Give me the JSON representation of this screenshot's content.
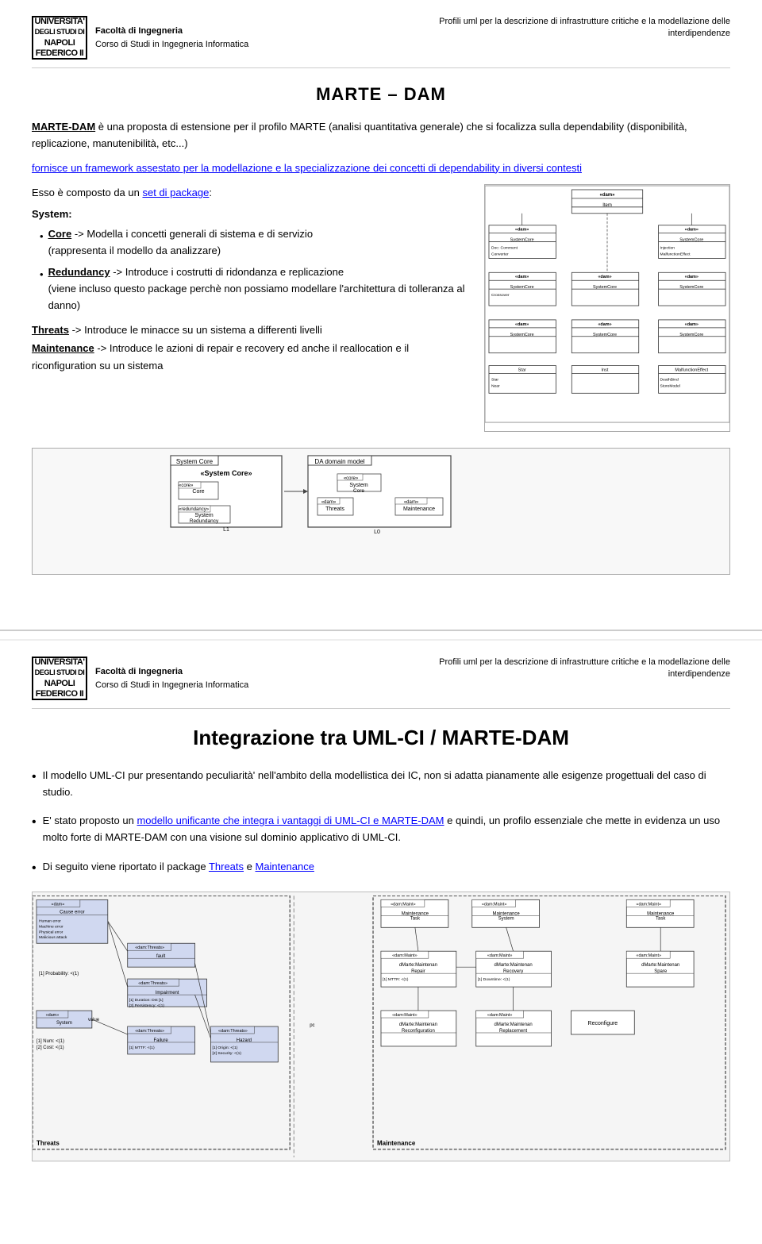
{
  "page1": {
    "header": {
      "logo_line1": "UNIVERSITA",
      "logo_line2": "DEGLI STUDI DI",
      "logo_line3": "NAPOLI FEDERICO II",
      "faculty": "Facoltà di Ingegneria",
      "course": "Corso di Studi in Ingegneria Informatica",
      "header_right": "Profili uml per la descrizione di infrastrutture critiche e la modellazione delle interdipendenze"
    },
    "title": "MARTE – DAM",
    "intro": {
      "part1_strong": "MARTE-DAM",
      "part1": " è una proposta di estensione per il profilo MARTE (analisi quantitativa generale) che si focalizza sulla dependability (disponibilità, replicazione, manutenibilità, etc...)",
      "part2_link": "fornisce un framework assestato per la modellazione e la specializzazione dei concetti di dependability in diversi contesti"
    },
    "set_text": "Esso è composto da un ",
    "set_link": "set di package",
    "set_text2": ":",
    "system_label": "System:",
    "packages": [
      {
        "name": "Core",
        "arrow": "->",
        "desc1": "Modella i concetti generali di sistema e di servizio",
        "desc2": "(rappresenta il modello da analizzare)"
      },
      {
        "name": "Redundancy",
        "arrow": "->",
        "desc1": "Introduce i costrutti di ridondanza e replicazione",
        "desc2": "(viene incluso questo package perchè  non possiamo modellare l'architettura di tolleranza al  danno)"
      }
    ],
    "threats_text": "Threats -> Introduce le minacce su un sistema a differenti livelli",
    "maintenance_text": "Maintenance -> Introduce le azioni di repair e recovery ed anche il reallocation e il riconfiguration su un sistema",
    "threats_label": "Threats",
    "maintenance_label": "Maintenance"
  },
  "page2": {
    "header": {
      "logo_line1": "UNIVERSITA",
      "logo_line2": "DEGLI STUDI DI",
      "logo_line3": "NAPOLI FEDERICO II",
      "faculty": "Facoltà di Ingegneria",
      "course": "Corso di Studi in Ingegneria Informatica",
      "header_right": "Profili uml per la descrizione di infrastrutture critiche e la modellazione delle interdipendenze"
    },
    "title": "Integrazione tra UML-CI / MARTE-DAM",
    "bullet1": "Il modello UML-CI pur presentando peculiarità' nell'ambito della modellistica dei IC, non si adatta pianamente alle esigenze progettuali del caso di studio.",
    "bullet2_pre": "E' stato proposto un ",
    "bullet2_link": "modello unificante che integra i vantaggi di UML-CI e MARTE-DAM",
    "bullet2_post": " e quindi, un profilo essenziale che mette in evidenza un uso molto forte di MARTE-DAM con una visione sul dominio applicativo di UML-CI.",
    "bullet3_pre": "Di seguito viene riportato il package ",
    "bullet3_link1": "Threats",
    "bullet3_mid": " e ",
    "bullet3_link2": "Maintenance"
  }
}
